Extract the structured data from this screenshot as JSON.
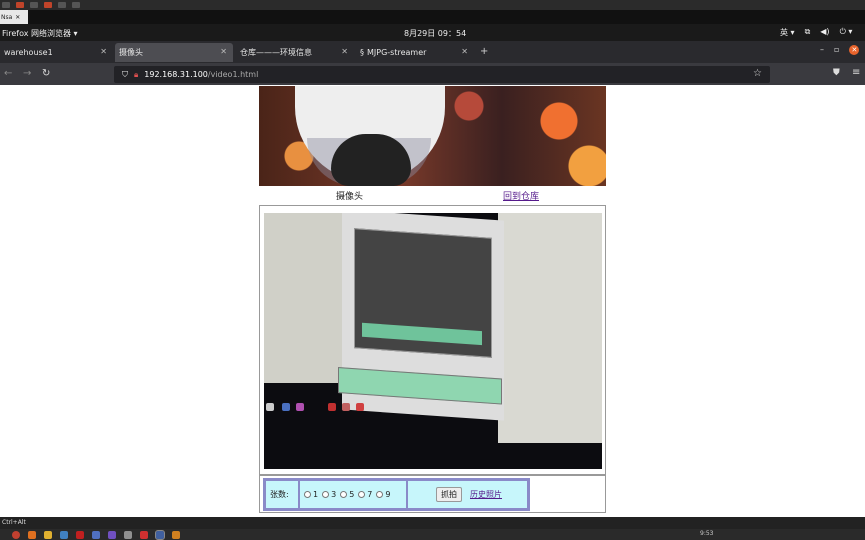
{
  "host": {
    "tab_label": "Nsa",
    "tab_close": "✕"
  },
  "gnome": {
    "app_menu": "Firefox 网络浏览器 ▾",
    "clock": "8月29日  09：54",
    "lang": "英 ▾",
    "icons": [
      "network-icon",
      "volume-icon",
      "power-icon"
    ]
  },
  "browser": {
    "tabs": [
      {
        "label": "warehouse1",
        "active": false
      },
      {
        "label": "摄像头",
        "active": true
      },
      {
        "label": "仓库———环境信息",
        "active": false
      },
      {
        "label": "MJPG-streamer",
        "active": false
      }
    ],
    "new_tab": "+",
    "tab_close": "✕",
    "url_host": "192.168.31.100",
    "url_path": "/video1.html",
    "win_min": "–",
    "win_max": "▫",
    "win_close": "✕"
  },
  "page": {
    "title": "摄像头",
    "back_link": "回到仓库",
    "control": {
      "count_label": "张数:",
      "options": [
        "1",
        "3",
        "5",
        "7",
        "9"
      ],
      "capture_button": "抓拍",
      "history_link": "历史照片"
    }
  },
  "taskbar": {
    "top_text": "Ctrl+Alt",
    "time": "9:53"
  }
}
